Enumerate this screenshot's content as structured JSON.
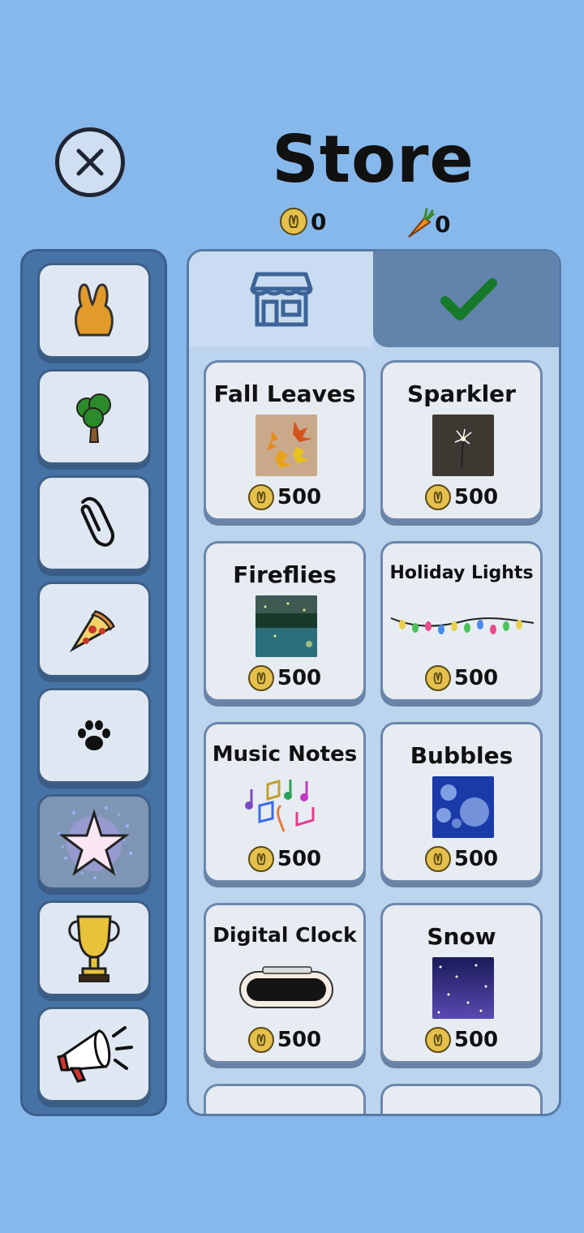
{
  "header": {
    "title": "Store"
  },
  "currency": {
    "coins": "0",
    "carrots": "0"
  },
  "sidebar": {
    "items": [
      {
        "icon": "bunny-icon"
      },
      {
        "icon": "tree-icon"
      },
      {
        "icon": "paperclip-icon"
      },
      {
        "icon": "pizza-icon"
      },
      {
        "icon": "paw-icon"
      },
      {
        "icon": "sparkle-star-icon",
        "selected": true
      },
      {
        "icon": "trophy-icon"
      },
      {
        "icon": "megaphone-icon"
      }
    ]
  },
  "tabs": {
    "store_icon": "storefront-icon",
    "owned_icon": "checkmark-icon"
  },
  "items": [
    {
      "name": "Fall Leaves",
      "price": "500"
    },
    {
      "name": "Sparkler",
      "price": "500"
    },
    {
      "name": "Fireflies",
      "price": "500"
    },
    {
      "name": "Holiday Lights",
      "price": "500"
    },
    {
      "name": "Music Notes",
      "price": "500"
    },
    {
      "name": "Bubbles",
      "price": "500"
    },
    {
      "name": "Digital Clock",
      "price": "500"
    },
    {
      "name": "Snow",
      "price": "500"
    }
  ],
  "colors": {
    "background": "#86b8ec",
    "sidebar": "#4673a6",
    "panel": "#bdd4ee",
    "check": "#157a2a",
    "coin": "#e5c04d"
  }
}
